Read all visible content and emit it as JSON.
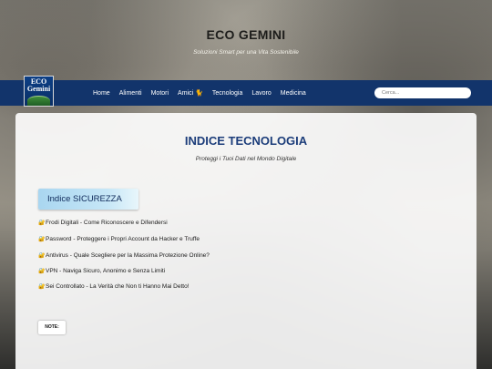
{
  "header": {
    "title": "ECO GEMINI",
    "tagline": "Soluzioni Smart per una Vita Sostenibile"
  },
  "logo": {
    "line1": "ECO",
    "line2": "Gemini"
  },
  "nav": {
    "items": [
      {
        "label": "Home"
      },
      {
        "label": "Alimenti"
      },
      {
        "label": "Motori"
      },
      {
        "label": "Amici",
        "icon": "🐈"
      },
      {
        "label": "Tecnologia"
      },
      {
        "label": "Lavoro"
      },
      {
        "label": "Medicina"
      }
    ]
  },
  "search": {
    "placeholder": "Cerca..."
  },
  "main": {
    "title": "INDICE TECNOLOGIA",
    "subtitle": "Proteggi i Tuoi Dati nel Mondo Digitale",
    "section_title": "Indice SICUREZZA",
    "links": [
      {
        "icon": "🔐",
        "text": "Frodi Digitali - Come Riconoscere e Difendersi"
      },
      {
        "icon": "🔐",
        "text": "Password - Proteggere i Propri Account da Hacker e Truffe"
      },
      {
        "icon": "🔐",
        "text": "Antivirus - Quale Scegliere per la Massima Protezione Online?"
      },
      {
        "icon": "🔐",
        "text": "VPN - Naviga Sicuro, Anonimo e Senza Limiti"
      },
      {
        "icon": "🔐",
        "text": "Sei Controllato - La Verità che Non ti Hanno Mai Detto!"
      }
    ],
    "note_label": "NOTE:"
  },
  "colors": {
    "navbar": "#12346b",
    "title": "#1c3d7a",
    "section_badge": "#a9d6f0"
  }
}
